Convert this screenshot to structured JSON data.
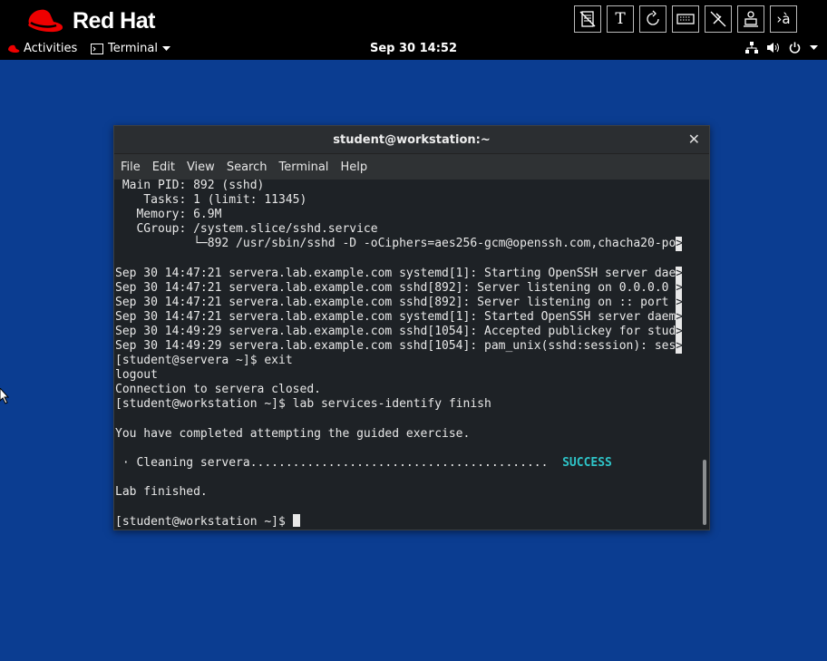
{
  "top_bar": {
    "brand": "Red Hat",
    "toolbar_icons": [
      {
        "name": "document-icon",
        "label": ""
      },
      {
        "name": "text-icon",
        "label": "T"
      },
      {
        "name": "refresh-icon",
        "label": ""
      },
      {
        "name": "keyboard-icon",
        "label": ""
      },
      {
        "name": "no-tools-icon",
        "label": ""
      },
      {
        "name": "user-icon",
        "label": ""
      },
      {
        "name": "input-method-icon",
        "label": "›à"
      }
    ]
  },
  "panel": {
    "activities": "Activities",
    "app_menu": "Terminal",
    "clock": "Sep 30  14:52"
  },
  "terminal": {
    "title": "student@workstation:~",
    "menu": [
      "File",
      "Edit",
      "View",
      "Search",
      "Terminal",
      "Help"
    ],
    "lines": [
      " Main PID: 892 (sshd)",
      "    Tasks: 1 (limit: 11345)",
      "   Memory: 6.9M",
      "   CGroup: /system.slice/sshd.service",
      "           └─892 /usr/sbin/sshd -D -oCiphers=aes256-gcm@openssh.com,chacha20-po",
      "",
      "Sep 30 14:47:21 servera.lab.example.com systemd[1]: Starting OpenSSH server dae",
      "Sep 30 14:47:21 servera.lab.example.com sshd[892]: Server listening on 0.0.0.0 ",
      "Sep 30 14:47:21 servera.lab.example.com sshd[892]: Server listening on :: port ",
      "Sep 30 14:47:21 servera.lab.example.com systemd[1]: Started OpenSSH server daem",
      "Sep 30 14:49:29 servera.lab.example.com sshd[1054]: Accepted publickey for stud",
      "Sep 30 14:49:29 servera.lab.example.com sshd[1054]: pam_unix(sshd:session): ses",
      "[student@servera ~]$ exit",
      "logout",
      "Connection to servera closed.",
      "[student@workstation ~]$ lab services-identify finish",
      "",
      "You have completed attempting the guided exercise.",
      "",
      " · Cleaning servera..........................................  ",
      "",
      "Lab finished.",
      "",
      "[student@workstation ~]$ "
    ],
    "truncated_lines": [
      4,
      6,
      7,
      8,
      9,
      10,
      11
    ],
    "status_word": "SUCCESS",
    "status_line_index": 19,
    "truncation_marker": ">"
  },
  "colors": {
    "desktop": "#0b3d91",
    "success": "#2ec4c8",
    "redhat_red": "#ee0000"
  }
}
